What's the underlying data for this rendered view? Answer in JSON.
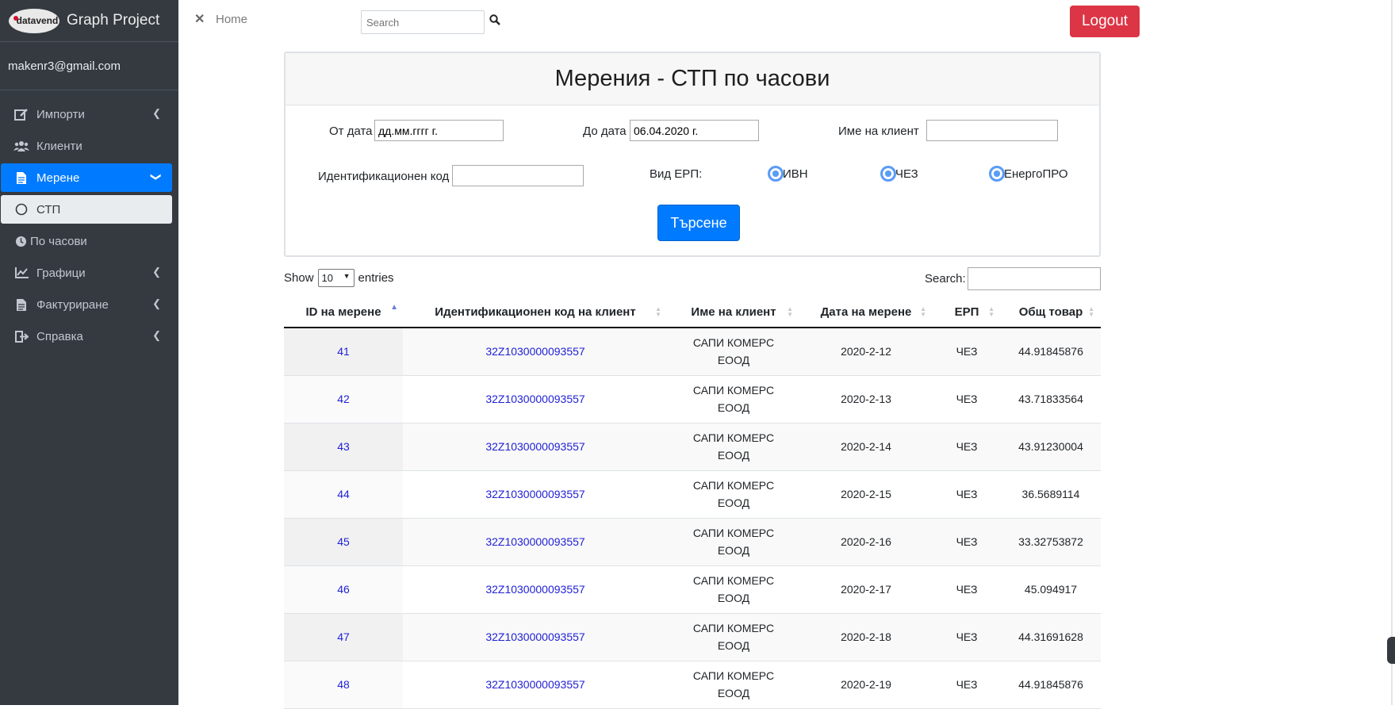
{
  "brand": {
    "logo_text": "datavend",
    "title": "Graph Project"
  },
  "user": {
    "email": "makenr3@gmail.com"
  },
  "sidebar": {
    "items": [
      {
        "label": "Импорти",
        "icon": "edit-icon"
      },
      {
        "label": "Клиенти",
        "icon": "users-icon"
      },
      {
        "label": "Мерене",
        "icon": "file-icon"
      },
      {
        "label": "СТП",
        "icon": "circle-icon"
      },
      {
        "label": "По часови",
        "icon": "clock-icon"
      },
      {
        "label": "Графици",
        "icon": "chart-icon"
      },
      {
        "label": "Фактуриране",
        "icon": "file-icon"
      },
      {
        "label": "Справка",
        "icon": "sign-out-icon"
      }
    ]
  },
  "topbar": {
    "home": "Home",
    "search_placeholder": "Search",
    "logout": "Logout"
  },
  "filter": {
    "title": "Мерения - СТП по часови",
    "from_label": "От дата",
    "from_value": "дд.мм.гггг г.",
    "to_label": "До дата",
    "to_value": "06.04.2020 г.",
    "client_label": "Име на клиент",
    "client_value": "",
    "code_label": "Идентификационен код",
    "code_value": "",
    "erp_label": "Вид ЕРП:",
    "erp_options": [
      "ИВН",
      "ЧЕЗ",
      "ЕнергоПРО"
    ],
    "submit": "Търсене"
  },
  "datatable": {
    "show_label": "Show",
    "page_size": "10",
    "entries_label": "entries",
    "search_label": "Search:",
    "search_value": "",
    "columns": [
      "ID на мерене",
      "Идентификационен код на клиент",
      "Име на клиент",
      "Дата на мерене",
      "ЕРП",
      "Общ товар"
    ],
    "rows": [
      {
        "id": "41",
        "code": "32Z1030000093557",
        "client": "САПИ КОМЕРС ЕООД",
        "date": "2020-2-12",
        "erp": "ЧЕЗ",
        "total": "44.91845876"
      },
      {
        "id": "42",
        "code": "32Z1030000093557",
        "client": "САПИ КОМЕРС ЕООД",
        "date": "2020-2-13",
        "erp": "ЧЕЗ",
        "total": "43.71833564"
      },
      {
        "id": "43",
        "code": "32Z1030000093557",
        "client": "САПИ КОМЕРС ЕООД",
        "date": "2020-2-14",
        "erp": "ЧЕЗ",
        "total": "43.91230004"
      },
      {
        "id": "44",
        "code": "32Z1030000093557",
        "client": "САПИ КОМЕРС ЕООД",
        "date": "2020-2-15",
        "erp": "ЧЕЗ",
        "total": "36.5689114"
      },
      {
        "id": "45",
        "code": "32Z1030000093557",
        "client": "САПИ КОМЕРС ЕООД",
        "date": "2020-2-16",
        "erp": "ЧЕЗ",
        "total": "33.32753872"
      },
      {
        "id": "46",
        "code": "32Z1030000093557",
        "client": "САПИ КОМЕРС ЕООД",
        "date": "2020-2-17",
        "erp": "ЧЕЗ",
        "total": "45.094917"
      },
      {
        "id": "47",
        "code": "32Z1030000093557",
        "client": "САПИ КОМЕРС ЕООД",
        "date": "2020-2-18",
        "erp": "ЧЕЗ",
        "total": "44.31691628"
      },
      {
        "id": "48",
        "code": "32Z1030000093557",
        "client": "САПИ КОМЕРС ЕООД",
        "date": "2020-2-19",
        "erp": "ЧЕЗ",
        "total": "44.91845876"
      }
    ]
  }
}
